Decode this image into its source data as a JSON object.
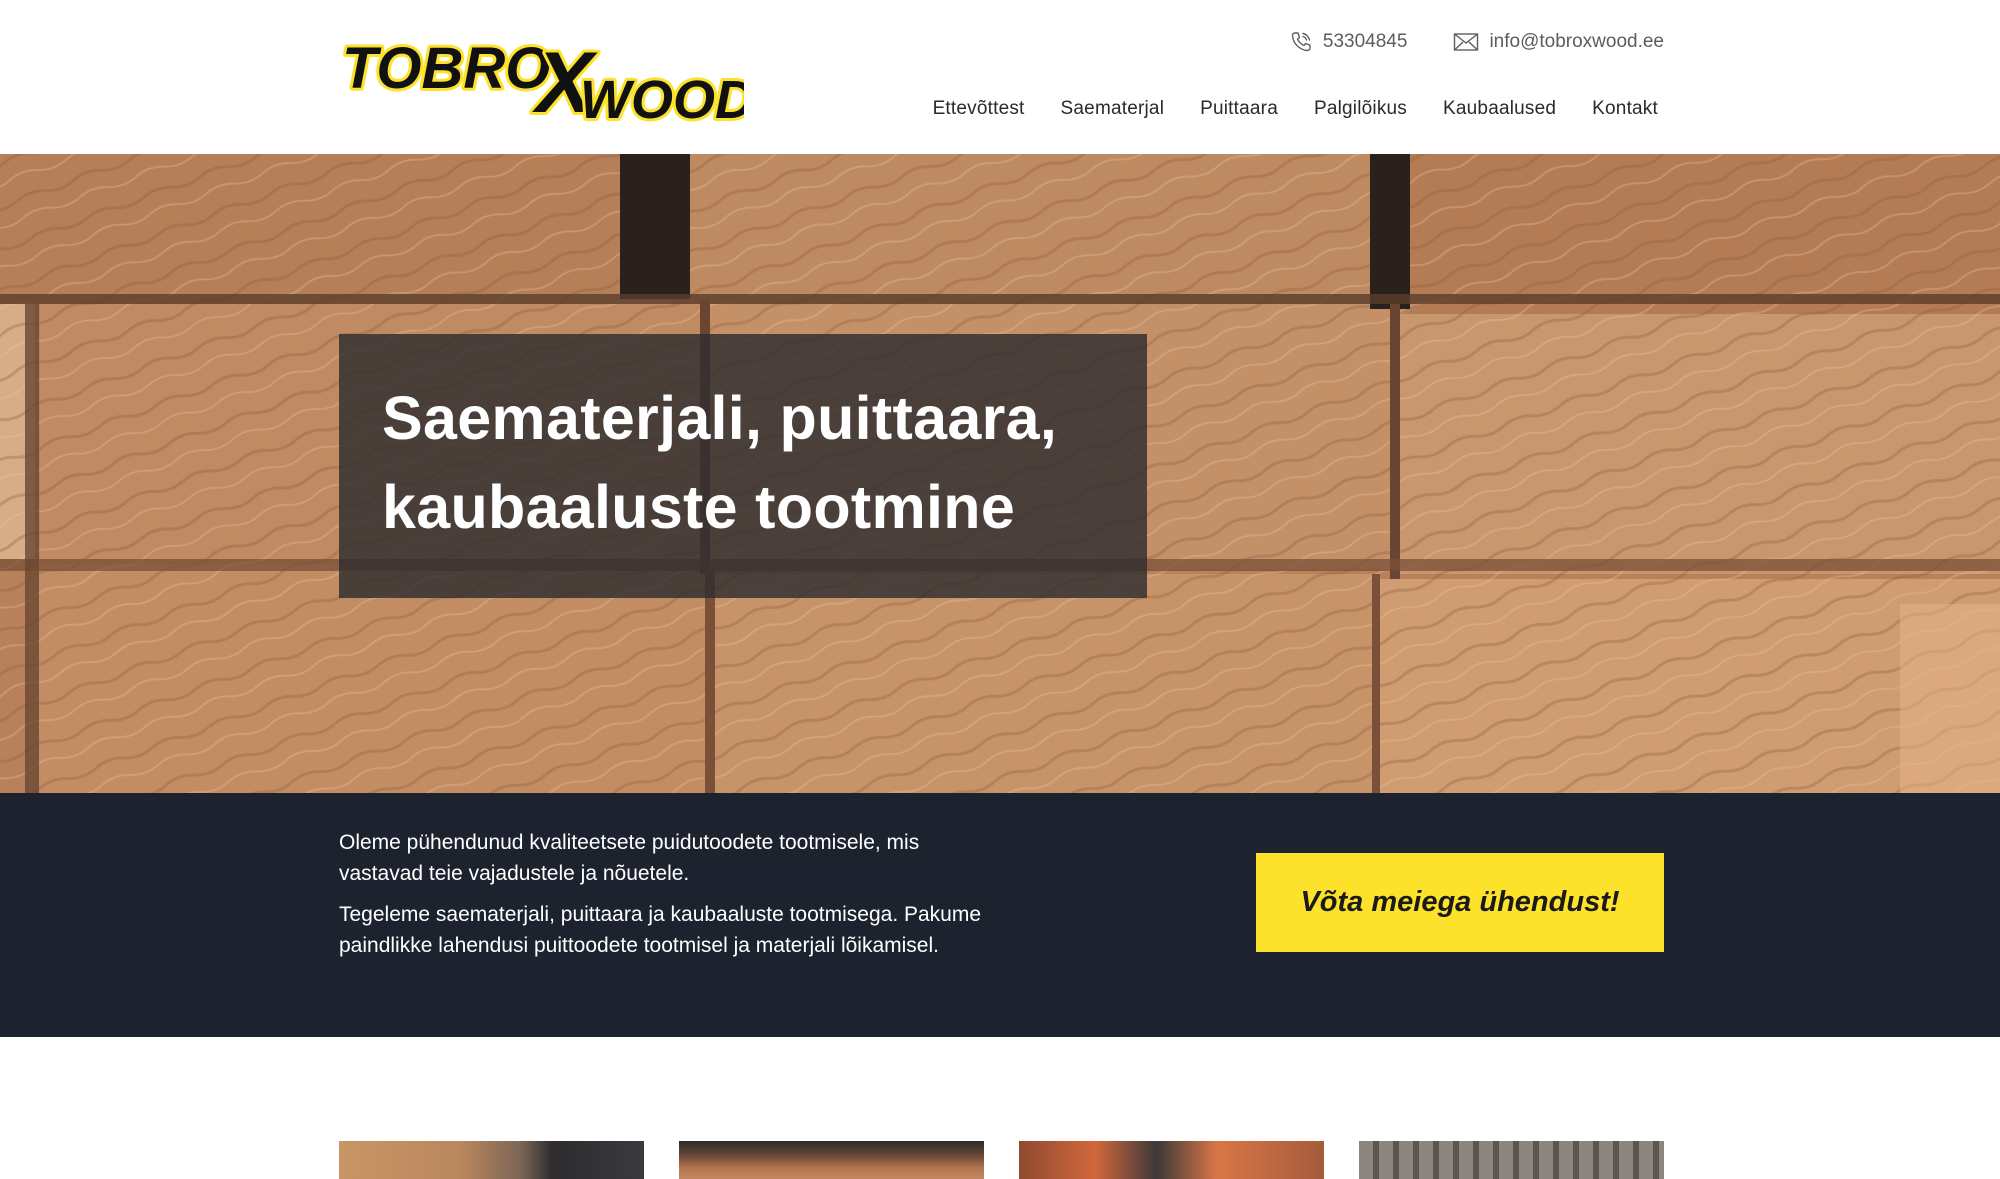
{
  "brand": {
    "name_part1": "TOBRO",
    "name_x": "X",
    "name_part2": "WOOD",
    "accent_color": "#fde22b",
    "dark_color": "#1c222e"
  },
  "header": {
    "phone": {
      "icon": "phone-icon",
      "text": "53304845"
    },
    "email": {
      "icon": "mail-icon",
      "text": "info@tobroxwood.ee"
    },
    "nav": [
      {
        "label": "Ettevõttest"
      },
      {
        "label": "Saematerjal"
      },
      {
        "label": "Puittaara"
      },
      {
        "label": "Palgilõikus"
      },
      {
        "label": "Kaubaalused"
      },
      {
        "label": "Kontakt"
      }
    ]
  },
  "hero": {
    "title_line1": "Saematerjali, puittaara,",
    "title_line2": "kaubaaluste tootmine"
  },
  "intro": {
    "paragraph1": "Oleme pühendunud kvaliteetsete puidutoodete tootmisele, mis vastavad teie vajadustele ja nõuetele.",
    "paragraph2": "Tegeleme saematerjali, puittaara ja kaubaaluste tootmisega. Pakume paindlikke lahendusi puittoodete tootmisel ja materjali lõikamisel.",
    "cta_label": "Võta meiega ühendust!"
  }
}
